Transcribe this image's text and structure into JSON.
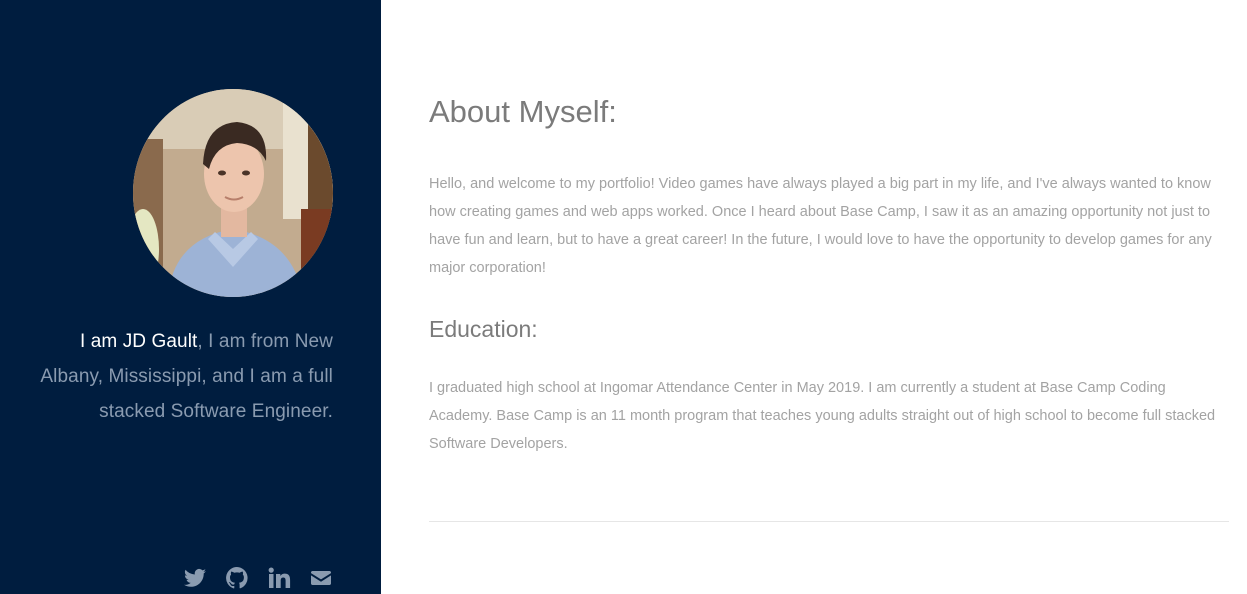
{
  "sidebar": {
    "avatar_alt": "Profile photo",
    "intro": {
      "name": "I am JD Gault",
      "rest": ", I am from New Albany, Mississippi, and I am a full stacked Software Engineer."
    },
    "social": [
      {
        "icon": "twitter-icon"
      },
      {
        "icon": "github-icon"
      },
      {
        "icon": "linkedin-icon"
      },
      {
        "icon": "envelope-icon"
      }
    ],
    "colors": {
      "background": "#001d3f",
      "text": "#8a9bb0",
      "name": "#ffffff"
    }
  },
  "main": {
    "about": {
      "title": "About Myself:",
      "text": "Hello, and welcome to my portfolio! Video games have always played a big part in my life, and I've always wanted to know how creating games and web apps worked. Once I heard about Base Camp, I saw it as an amazing opportunity not just to have fun and learn, but to have a great career! In the future, I would love to have the opportunity to develop games for any major corporation!"
    },
    "education": {
      "title": "Education:",
      "text": "I graduated high school at Ingomar Attendance Center in May 2019. I am currently a student at Base Camp Coding Academy. Base Camp is an 11 month program that teaches young adults straight out of high school to become full stacked Software Developers."
    }
  }
}
